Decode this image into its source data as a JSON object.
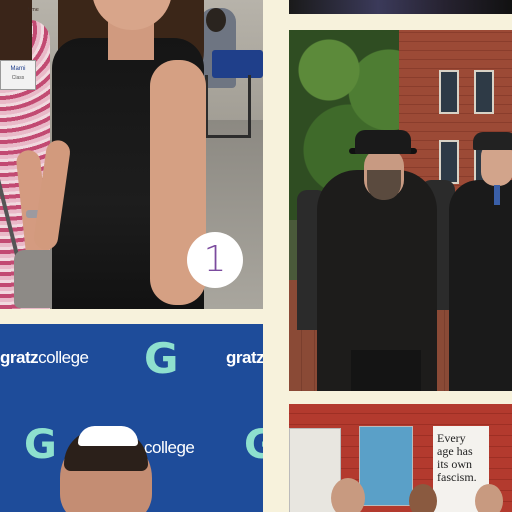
{
  "collage": {
    "photo_number_badge": "1",
    "tile_1": {
      "name_badge_name": "Marni",
      "name_badge_sub": "Class",
      "tattoo_text": "ᵗⁱᵐᵉ"
    },
    "tile_4": {
      "brand_bold": "gratz",
      "brand_light": "college",
      "logo_glyph": "G"
    },
    "tile_5": {
      "quote_lines": [
        "Every",
        "age has",
        "its own",
        "fascism."
      ]
    }
  },
  "colors": {
    "page_background": "#f7f2dc",
    "gratz_blue": "#1e4c9a",
    "gratz_logo_teal": "#8ee0ce",
    "badge_number_purple": "#7b4b9e",
    "brick_red": "#b33a2e"
  },
  "icons": [
    "gratz-g-logo-icon"
  ]
}
